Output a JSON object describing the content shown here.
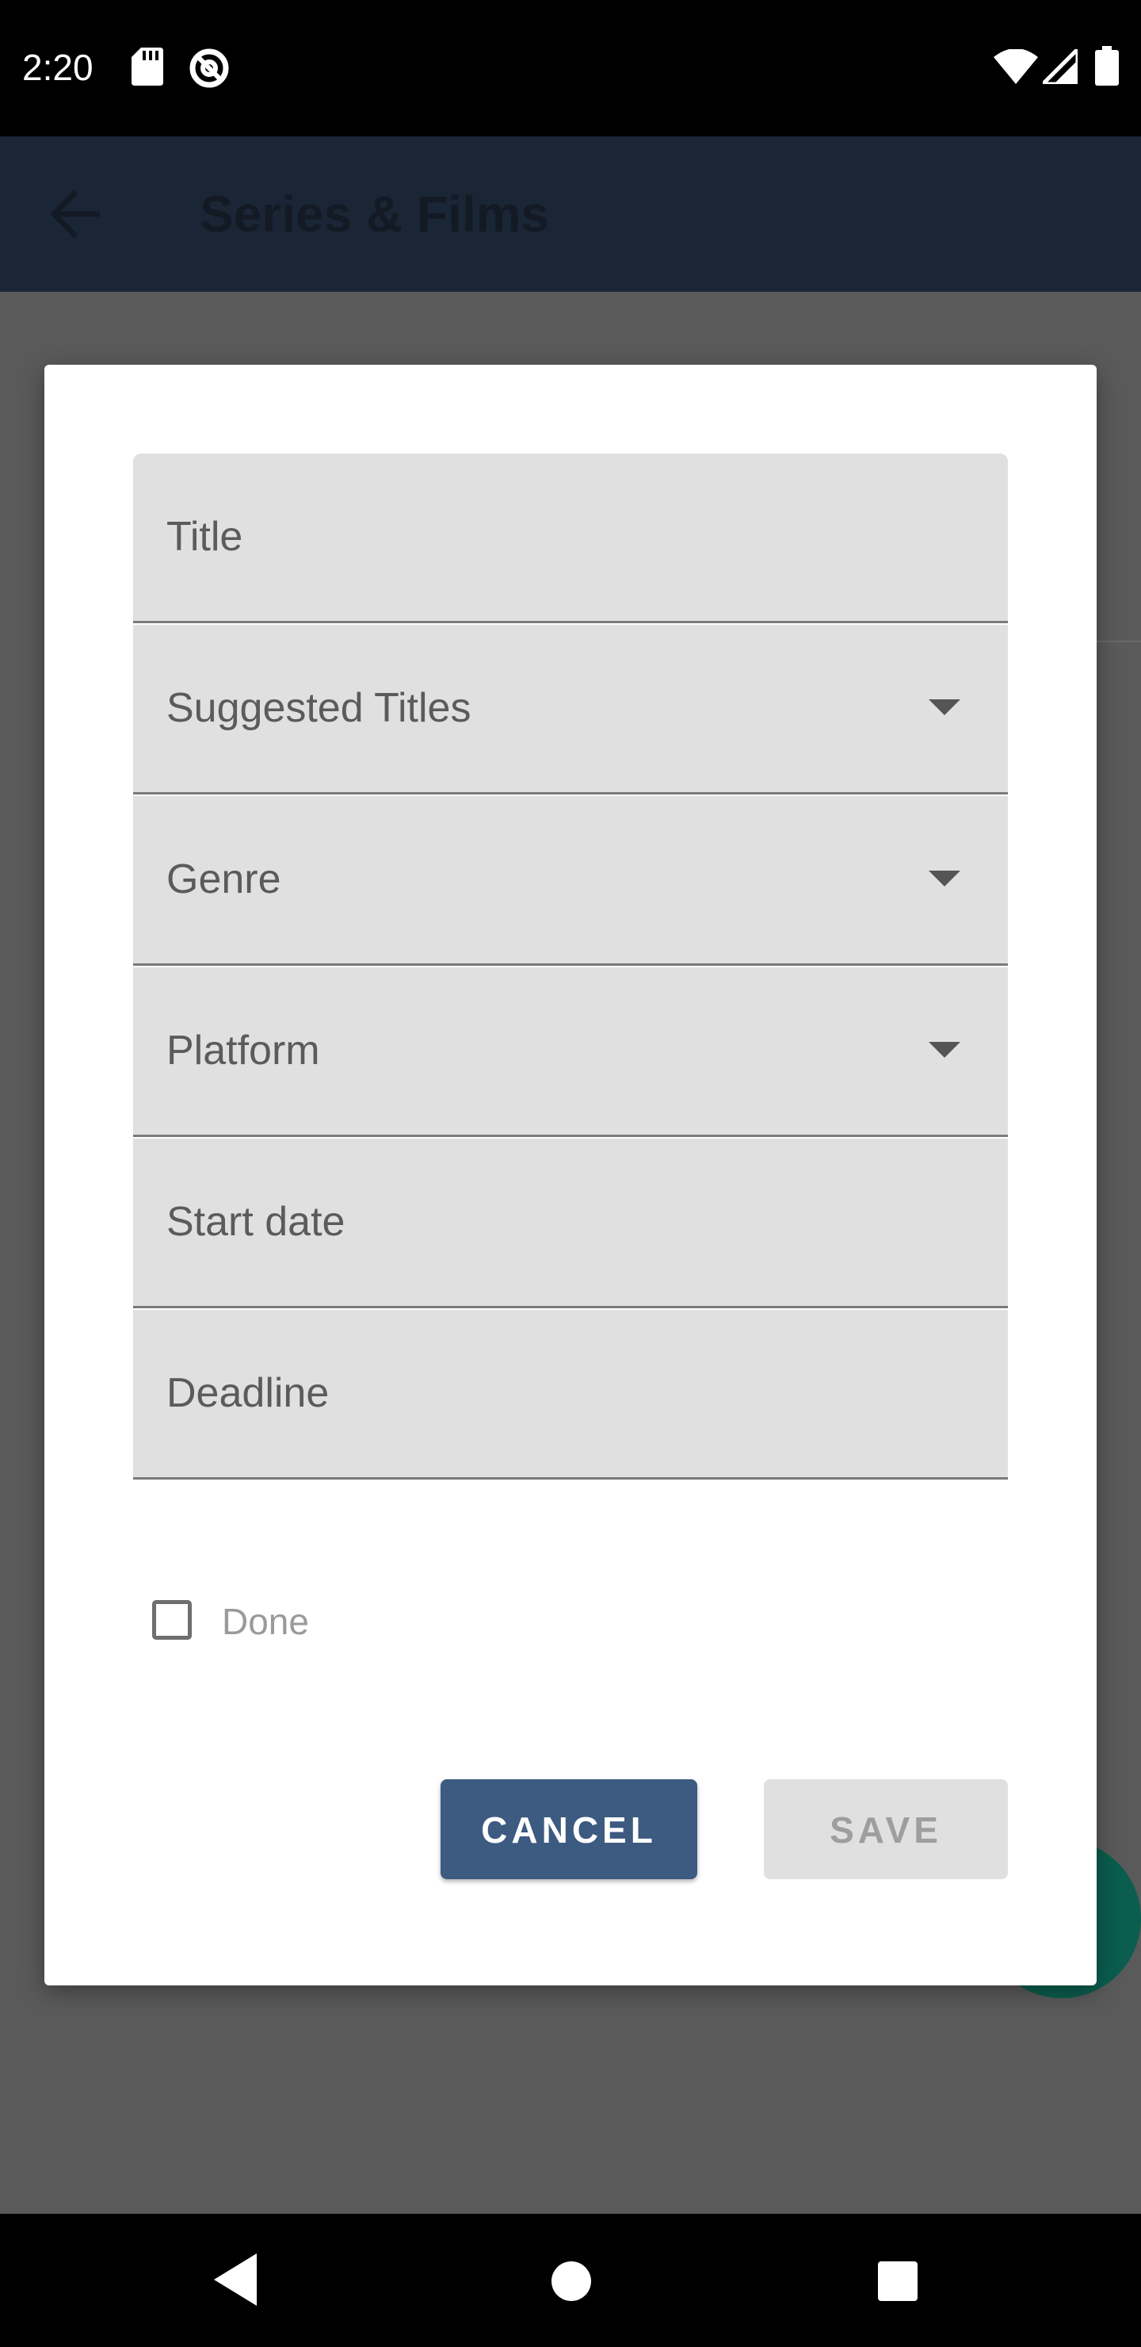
{
  "status_bar": {
    "time": "2:20",
    "icons": [
      "sd-card-icon",
      "do-not-disturb-icon",
      "wifi-icon",
      "signal-icon",
      "battery-icon"
    ]
  },
  "app_bar": {
    "title": "Series & Films",
    "back_icon": "arrow-back-icon",
    "color": "#1a2636"
  },
  "dialog": {
    "fields": [
      {
        "label": "Title",
        "type": "text"
      },
      {
        "label": "Suggested Titles",
        "type": "dropdown"
      },
      {
        "label": "Genre",
        "type": "dropdown"
      },
      {
        "label": "Platform",
        "type": "dropdown"
      },
      {
        "label": "Start date",
        "type": "text"
      },
      {
        "label": "Deadline",
        "type": "text"
      }
    ],
    "checkbox": {
      "label": "Done",
      "checked": false
    },
    "cancel_label": "CANCEL",
    "save_label": "SAVE",
    "accent_color": "#3d5a80"
  },
  "nav_bar": {
    "icons": [
      "nav-back-icon",
      "nav-home-icon",
      "nav-recents-icon"
    ]
  }
}
